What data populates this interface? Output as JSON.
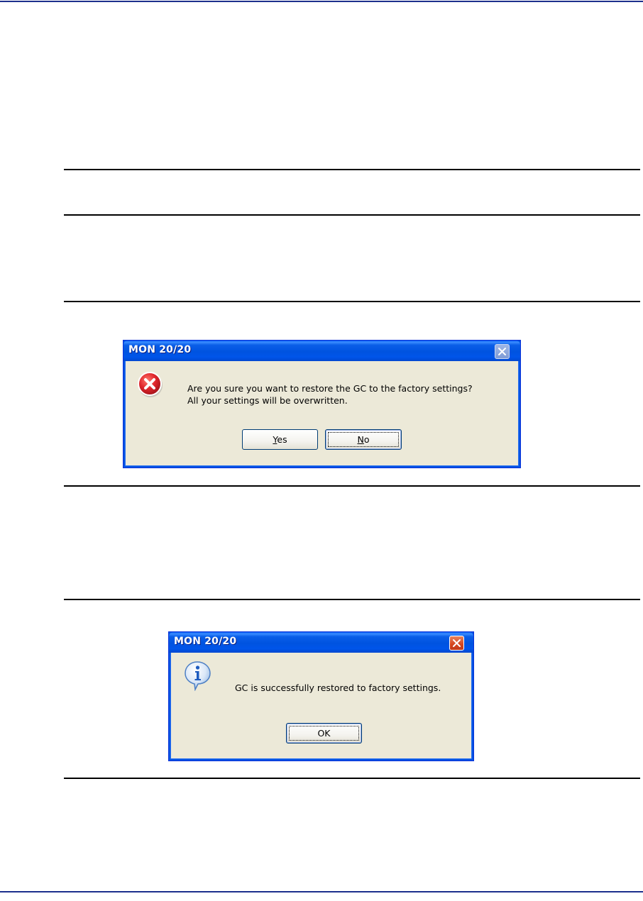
{
  "dialog_confirm": {
    "title": "MON 20/20",
    "message_line1": "Are you sure you want to restore the GC to the factory settings?",
    "message_line2": "All your settings will be overwritten.",
    "icon": "error-icon",
    "buttons": {
      "yes": {
        "mnemonic": "Y",
        "rest": "es"
      },
      "no": {
        "mnemonic": "N",
        "rest": "o"
      }
    }
  },
  "dialog_info": {
    "title": "MON 20/20",
    "message": "GC is successfully restored to factory settings.",
    "icon": "info-icon",
    "ok_label": "OK"
  },
  "colors": {
    "page_rule": "#1c2f8c",
    "titlebar": "#0053e0",
    "dialog_face": "#ece9d8",
    "error_red": "#d9232c",
    "info_blue": "#2b6ccf"
  }
}
